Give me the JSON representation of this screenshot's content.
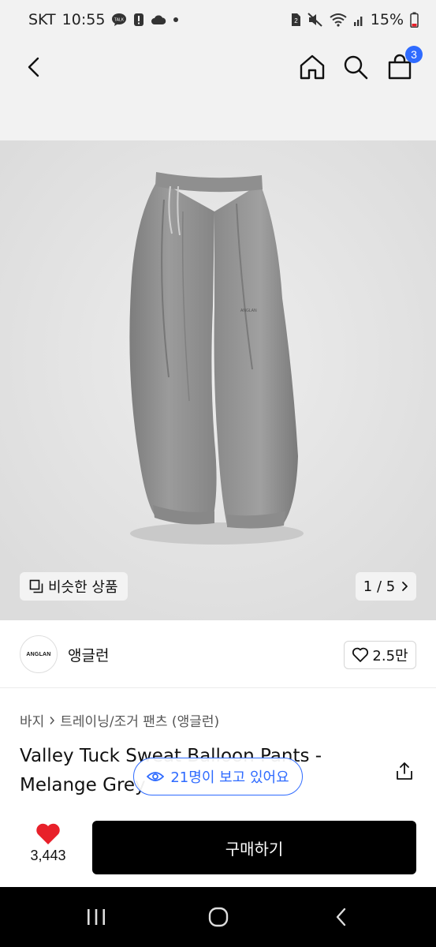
{
  "status_bar": {
    "carrier": "SKT",
    "time": "10:55",
    "battery": "15%"
  },
  "header": {
    "cart_count": "3"
  },
  "gallery": {
    "similar_label": "비슷한 상품",
    "page_counter": "1 / 5"
  },
  "brand": {
    "logo_text": "ANGLAN",
    "name": "앵글런",
    "like_count": "2.5만"
  },
  "breadcrumb": {
    "category": "바지",
    "subcategory": "트레이닝/조거 팬츠 (앵글런)"
  },
  "product": {
    "title": "Valley Tuck Sweat Balloon Pants - Melange Grey"
  },
  "viewers": {
    "label": "21명이 보고 있어요"
  },
  "bottom_bar": {
    "wish_count": "3,443",
    "buy_label": "구매하기"
  },
  "colors": {
    "accent": "#2f6bff",
    "wish_heart": "#e8202a",
    "buy_button": "#000000"
  }
}
